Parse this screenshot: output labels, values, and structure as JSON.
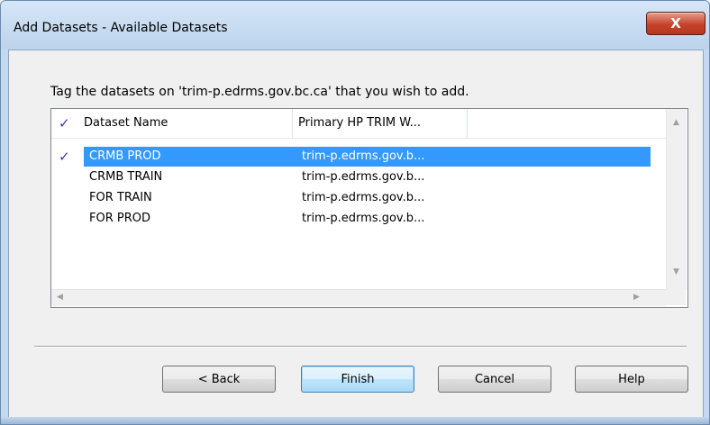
{
  "window": {
    "title": "Add Datasets - Available Datasets",
    "close_label": "X"
  },
  "instruction": "Tag the datasets on 'trim-p.edrms.gov.bc.ca' that you wish to add.",
  "list": {
    "header_check": "✓",
    "columns": [
      "Dataset Name",
      "Primary HP TRIM W..."
    ],
    "rows": [
      {
        "checked": true,
        "check": "✓",
        "name": "CRMB PROD",
        "server": "trim-p.edrms.gov.b...",
        "selected": true
      },
      {
        "checked": false,
        "check": "",
        "name": "CRMB TRAIN",
        "server": "trim-p.edrms.gov.b..."
      },
      {
        "checked": false,
        "check": "",
        "name": "FOR TRAIN",
        "server": "trim-p.edrms.gov.b..."
      },
      {
        "checked": false,
        "check": "",
        "name": "FOR PROD",
        "server": "trim-p.edrms.gov.b..."
      }
    ],
    "scroll_up": "▲",
    "scroll_down": "▼",
    "scroll_left": "◀",
    "scroll_right": "▶"
  },
  "buttons": {
    "back": "< Back",
    "finish": "Finish",
    "cancel": "Cancel",
    "help": "Help"
  },
  "colors": {
    "selection": "#3399ff",
    "check": "#5a2a9a",
    "close_button": "#c6432a"
  }
}
